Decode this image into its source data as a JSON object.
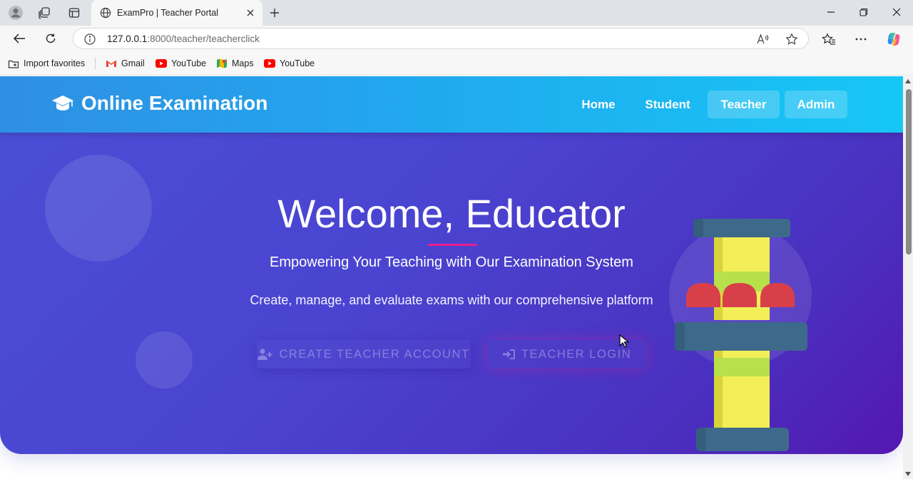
{
  "browser": {
    "tab_title": "ExamPro | Teacher Portal",
    "url_host": "127.0.0.1",
    "url_path": ":8000/teacher/teacherclick",
    "favorites": [
      {
        "label": "Import favorites",
        "icon": "import-icon"
      },
      {
        "label": "Gmail",
        "icon": "gmail-icon"
      },
      {
        "label": "YouTube",
        "icon": "youtube-icon"
      },
      {
        "label": "Maps",
        "icon": "maps-icon"
      },
      {
        "label": "YouTube",
        "icon": "youtube-icon"
      }
    ]
  },
  "navbar": {
    "brand": "Online Examination",
    "links": [
      "Home",
      "Student",
      "Teacher",
      "Admin"
    ]
  },
  "hero": {
    "title": "Welcome, Educator",
    "subtitle": "Empowering Your Teaching with Our Examination System",
    "description": "Create, manage, and evaluate exams with our comprehensive platform",
    "create_button": "CREATE TEACHER ACCOUNT",
    "login_button": "TEACHER LOGIN"
  },
  "colors": {
    "navbar_start": "#2f8fe3",
    "navbar_end": "#16c7f5",
    "hero_start": "#4a4fd6",
    "hero_end": "#5417b0",
    "accent_underline": "#e91e8c"
  }
}
